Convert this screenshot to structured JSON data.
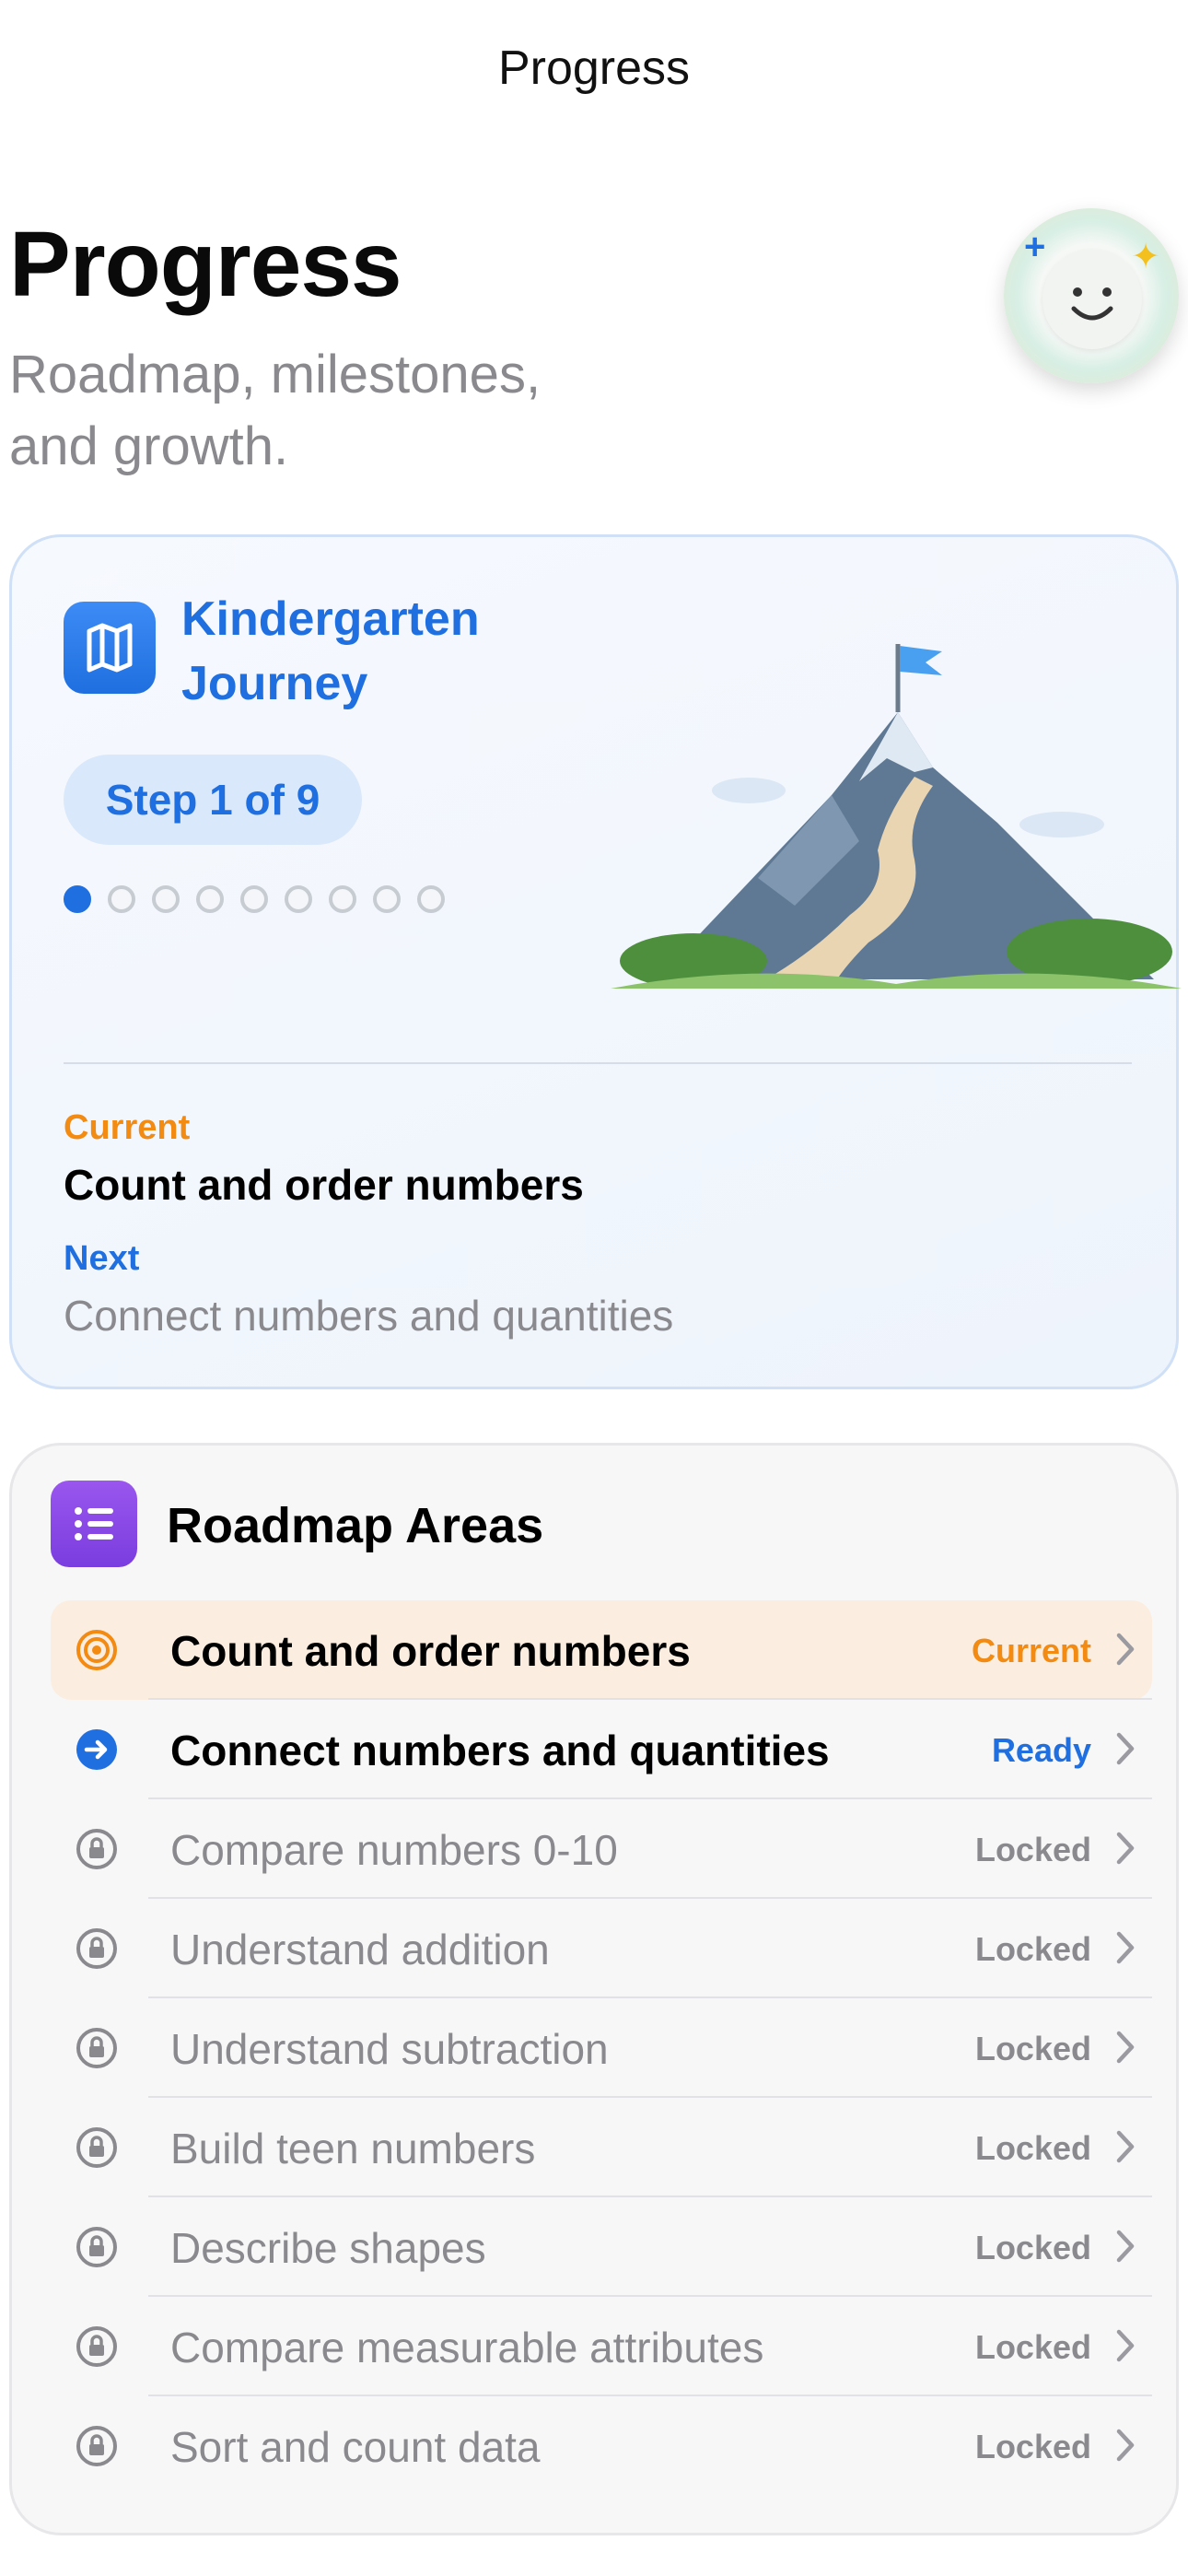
{
  "nav": {
    "title": "Progress"
  },
  "header": {
    "title": "Progress",
    "subtitle": "Roadmap, milestones, and growth."
  },
  "journey": {
    "title": "Kindergarten Journey",
    "step_label": "Step 1 of 9",
    "steps_total": 9,
    "steps_completed": 1,
    "current_label": "Current",
    "current_value": "Count and order numbers",
    "next_label": "Next",
    "next_value": "Connect numbers and quantities"
  },
  "roadmap": {
    "title": "Roadmap Areas",
    "items": [
      {
        "label": "Count and order numbers",
        "status": "Current",
        "state": "current",
        "icon": "target-icon"
      },
      {
        "label": "Connect numbers and quantities",
        "status": "Ready",
        "state": "ready",
        "icon": "arrow-right-circle-icon"
      },
      {
        "label": "Compare numbers 0-10",
        "status": "Locked",
        "state": "locked",
        "icon": "lock-icon"
      },
      {
        "label": "Understand addition",
        "status": "Locked",
        "state": "locked",
        "icon": "lock-icon"
      },
      {
        "label": "Understand subtraction",
        "status": "Locked",
        "state": "locked",
        "icon": "lock-icon"
      },
      {
        "label": "Build teen numbers",
        "status": "Locked",
        "state": "locked",
        "icon": "lock-icon"
      },
      {
        "label": "Describe shapes",
        "status": "Locked",
        "state": "locked",
        "icon": "lock-icon"
      },
      {
        "label": "Compare measurable attributes",
        "status": "Locked",
        "state": "locked",
        "icon": "lock-icon"
      },
      {
        "label": "Sort and count data",
        "status": "Locked",
        "state": "locked",
        "icon": "lock-icon"
      }
    ]
  },
  "colors": {
    "accent_blue": "#1f6fe0",
    "accent_orange": "#f38a12",
    "muted_gray": "#8a8a8e",
    "purple": "#7a3ddf"
  }
}
